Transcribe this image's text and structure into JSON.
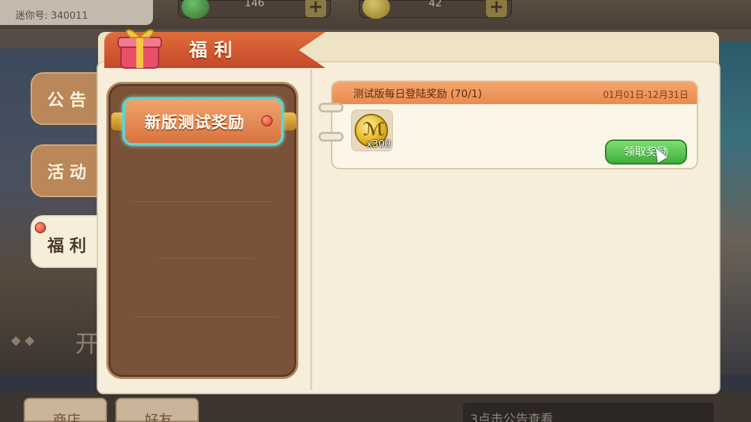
{
  "player": {
    "name": "迷你号",
    "id_text": "迷你号: 340011"
  },
  "resources": [
    {
      "value": "146",
      "icon": "green-gem-icon"
    },
    {
      "value": "42",
      "icon": "gold-coin-icon"
    }
  ],
  "background": {
    "big_text": "开",
    "diamonds": "◆ ◆"
  },
  "modal": {
    "title": "福利",
    "side_tabs": [
      {
        "label": "公告"
      },
      {
        "label": "活动"
      },
      {
        "label": "福利",
        "active": true
      }
    ],
    "list": {
      "items": [
        {
          "label": "新版测试奖励",
          "selected": true
        }
      ]
    },
    "reward": {
      "title": "测试版每日登陆奖励 (70/1)",
      "date_range": "01月01日-12月31日",
      "item": {
        "icon": "gold-coin-icon",
        "count": "x300"
      },
      "claim_label": "领取奖励"
    }
  },
  "bottom_bar": {
    "buttons": [
      {
        "label": "商店"
      },
      {
        "label": "好友"
      }
    ],
    "notice": "3点击公告查看"
  },
  "colors": {
    "title_ribbon": "#d85a30",
    "active_item_border": "#5fd4cf",
    "claim_button": "#4cba44",
    "reward_header": "#ef9659"
  }
}
